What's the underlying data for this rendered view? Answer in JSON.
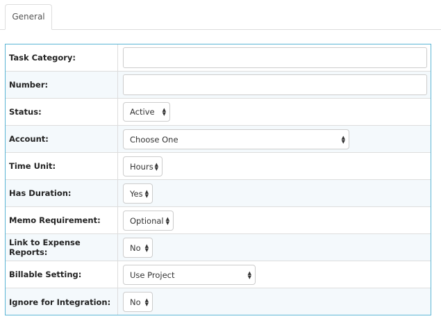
{
  "tabs": [
    {
      "label": "General"
    }
  ],
  "form": {
    "task_category": {
      "label": "Task Category:",
      "value": ""
    },
    "number": {
      "label": "Number:",
      "value": ""
    },
    "status": {
      "label": "Status:",
      "value": "Active"
    },
    "account": {
      "label": "Account:",
      "value": "Choose One"
    },
    "time_unit": {
      "label": "Time Unit:",
      "value": "Hours"
    },
    "has_duration": {
      "label": "Has Duration:",
      "value": "Yes"
    },
    "memo_requirement": {
      "label": "Memo Requirement:",
      "value": "Optional"
    },
    "link_expense": {
      "label": "Link to Expense Reports:",
      "value": "No"
    },
    "billable_setting": {
      "label": "Billable Setting:",
      "value": "Use Project"
    },
    "ignore_integration": {
      "label": "Ignore for Integration:",
      "value": "No"
    }
  },
  "colors": {
    "form_border": "#5bb5d5",
    "alt_row": "#f4f9fc",
    "divider": "#dddddd"
  },
  "icons": {
    "select_arrows": "updown-chevron-icon"
  }
}
